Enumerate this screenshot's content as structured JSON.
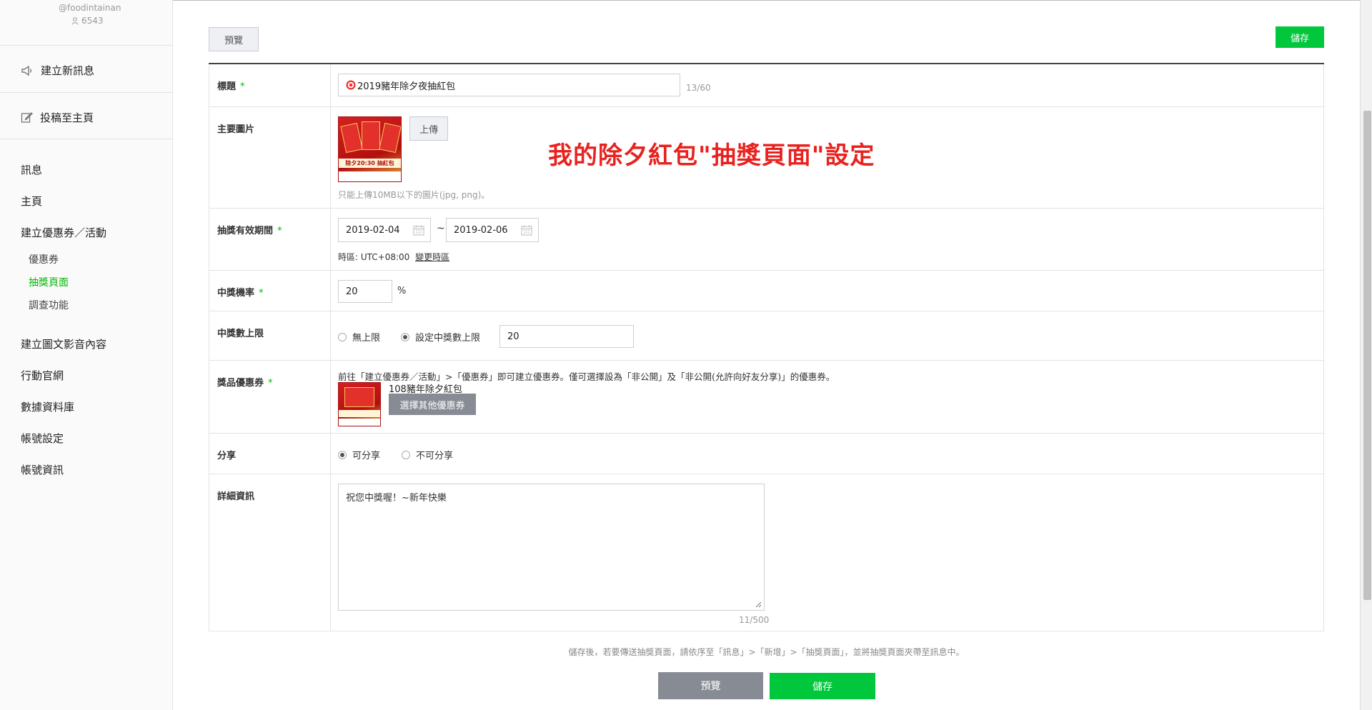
{
  "account": {
    "id": "@foodintainan",
    "friends": "6543"
  },
  "sidebar": {
    "create_message": "建立新訊息",
    "post_home": "投稿至主頁",
    "items": [
      "訊息",
      "主頁",
      "建立優惠券／活動"
    ],
    "sub_items": [
      "優惠券",
      "抽獎頁面",
      "調查功能"
    ],
    "active_sub": "抽獎頁面",
    "items2": [
      "建立圖文影音內容",
      "行動官網",
      "數據資料庫",
      "帳號設定",
      "帳號資訊"
    ]
  },
  "toolbar": {
    "preview": "預覽",
    "save": "儲存"
  },
  "form": {
    "title": {
      "label": "標題",
      "required": "*",
      "value": "2019豬年除夕夜抽紅包",
      "count": "13/60"
    },
    "main_image": {
      "label": "主要圖片",
      "upload": "上傳",
      "hint": "只能上傳10MB以下的圖片(jpg, png)。",
      "image_text": "除夕20:30 抽紅包"
    },
    "period": {
      "label": "抽獎有效期間",
      "required": "*",
      "start": "2019-02-04",
      "sep": "~",
      "end": "2019-02-06",
      "timezone": "時區: UTC+08:00",
      "change_tz": "變更時區"
    },
    "rate": {
      "label": "中獎機率",
      "required": "*",
      "value": "20",
      "unit": "%"
    },
    "limit": {
      "label": "中獎數上限",
      "opt_unlimited": "無上限",
      "opt_set": "設定中獎數上限",
      "selected": "opt_set",
      "value": "20"
    },
    "coupon": {
      "label": "獎品優惠券",
      "required": "*",
      "desc": "前往「建立優惠券／活動」>「優惠券」即可建立優惠券。僅可選擇設為「非公開」及「非公開(允許向好友分享)」的優惠券。",
      "name": "108豬年除夕紅包",
      "select_btn": "選擇其他優惠券"
    },
    "share": {
      "label": "分享",
      "opt_yes": "可分享",
      "opt_no": "不可分享",
      "selected": "opt_yes"
    },
    "details": {
      "label": "詳細資訊",
      "value": "祝您中獎喔！~新年快樂",
      "count": "11/500"
    }
  },
  "overlay_title": "我的除夕紅包\"抽獎頁面\"設定",
  "footnote": "儲存後，若要傳送抽獎頁面，請依序至「訊息」>「新增」>「抽獎頁面」，並將抽獎頁面夾帶至訊息中。",
  "footer": {
    "preview": "預覽",
    "save": "儲存"
  },
  "colors": {
    "brand_green": "#00c73c",
    "active_green": "#00b900",
    "overlay_red": "#e8221f"
  }
}
